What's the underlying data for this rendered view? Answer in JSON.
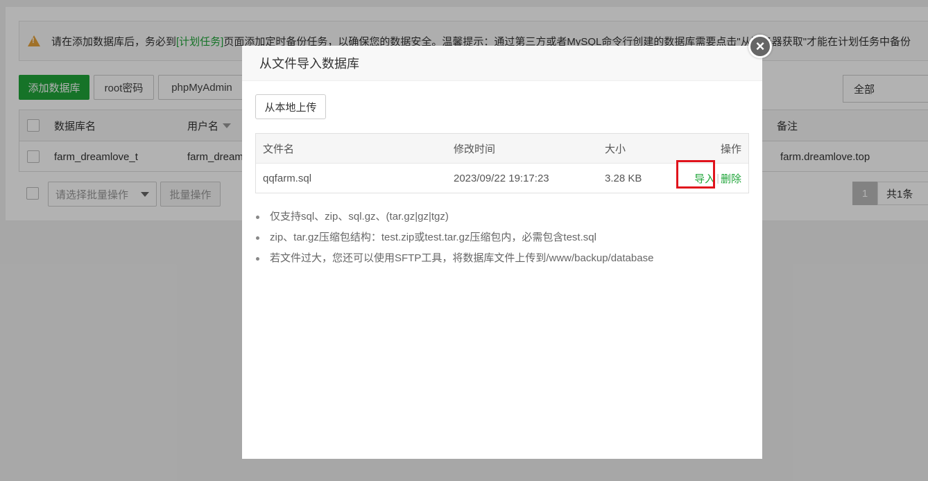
{
  "alert": {
    "before": "请在添加数据库后，务必到",
    "link": "[计划任务]",
    "after": "页面添加定时备份任务，以确保您的数据安全。温馨提示：通过第三方或者MySQL命令行创建的数据库需要点击\"从服务器获取\"才能在计划任务中备份"
  },
  "toolbar": {
    "add_db": "添加数据库",
    "root_pwd": "root密码",
    "phpmyadmin": "phpMyAdmin",
    "filter_value": "全部"
  },
  "db_table": {
    "headers": {
      "name": "数据库名",
      "user": "用户名",
      "note": "备注"
    },
    "rows": [
      {
        "name": "farm_dreamlove_t",
        "user": "farm_dream",
        "note": "farm.dreamlove.top"
      }
    ]
  },
  "bulk": {
    "select_placeholder": "请选择批量操作",
    "button": "批量操作"
  },
  "pagination": {
    "current": "1",
    "total": "共1条"
  },
  "modal": {
    "title": "从文件导入数据库",
    "close": "×",
    "upload_button": "从本地上传",
    "file_table": {
      "headers": {
        "name": "文件名",
        "mtime": "修改时间",
        "size": "大小",
        "ops": "操作"
      },
      "rows": [
        {
          "name": "qqfarm.sql",
          "mtime": "2023/09/22 19:17:23",
          "size": "3.28 KB",
          "import": "导入",
          "sep": "|",
          "delete": "删除"
        }
      ]
    },
    "tips": [
      "仅支持sql、zip、sql.gz、(tar.gz|gz|tgz)",
      "zip、tar.gz压缩包结构：test.zip或test.tar.gz压缩包内，必需包含test.sql",
      "若文件过大，您还可以使用SFTP工具，将数据库文件上传到/www/backup/database"
    ]
  },
  "colors": {
    "brand_green": "#20a53a",
    "highlight_red": "#e0131c",
    "warning": "#e6a23c"
  },
  "icons": [
    "warning-icon",
    "close-icon",
    "caret-down-icon"
  ]
}
